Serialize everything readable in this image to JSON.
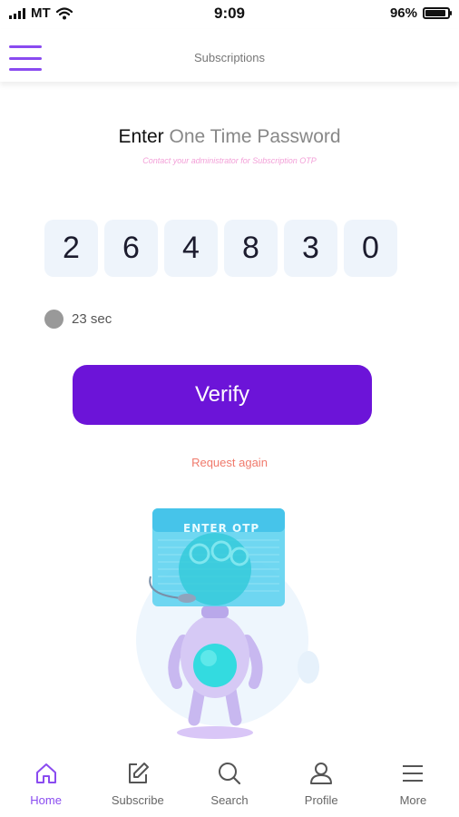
{
  "status_bar": {
    "carrier": "MT",
    "time": "9:09",
    "battery": "96%"
  },
  "header": {
    "title": "Subscriptions"
  },
  "heading": {
    "strong": "Enter",
    "light": "One Time Password"
  },
  "subheading": "Contact your administrator for Subscription OTP",
  "otp": {
    "digits": [
      "2",
      "6",
      "4",
      "8",
      "3",
      "0"
    ]
  },
  "timer": {
    "text": "23 sec"
  },
  "verify_label": "Verify",
  "request_again": "Request again",
  "illustration": {
    "sign_text": "ENTER OTP"
  },
  "nav": {
    "items": [
      {
        "label": "Home",
        "icon": "home-icon",
        "active": true
      },
      {
        "label": "Subscribe",
        "icon": "edit-icon",
        "active": false
      },
      {
        "label": "Search",
        "icon": "search-icon",
        "active": false
      },
      {
        "label": "Profile",
        "icon": "user-icon",
        "active": false
      },
      {
        "label": "More",
        "icon": "menu-icon",
        "active": false
      }
    ]
  },
  "colors": {
    "accent": "#8a4bf0",
    "button": "#6c14d8",
    "otp_box": "#eef4fb",
    "request_link": "#f07a6c",
    "subheading": "#f3a0d8"
  }
}
